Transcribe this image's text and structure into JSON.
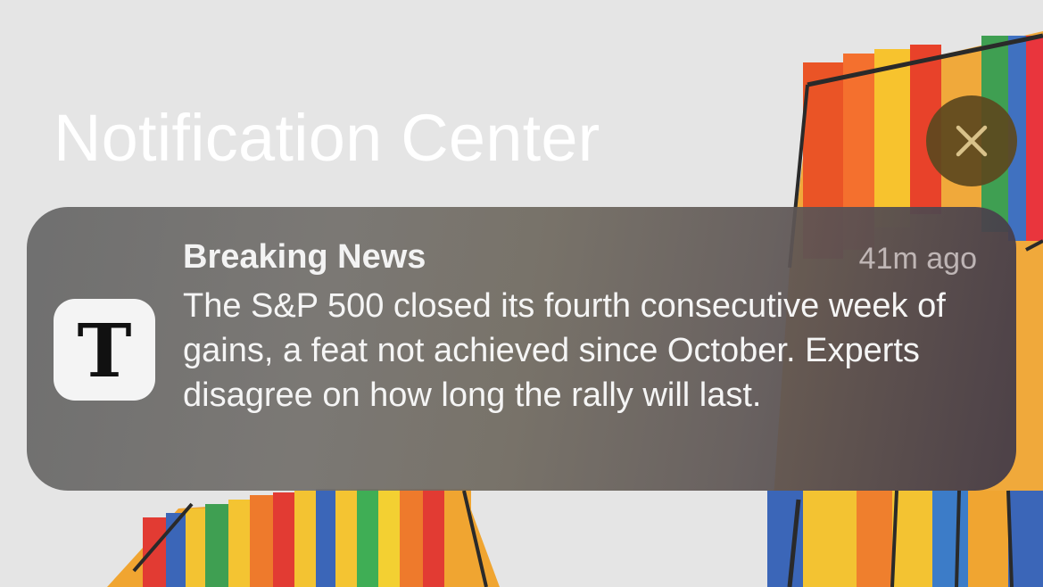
{
  "header": {
    "title": "Notification Center",
    "close_icon": "close-icon"
  },
  "notification": {
    "app_icon": "nyt-logo-icon",
    "app_icon_glyph": "T",
    "title": "Breaking News",
    "time": "41m ago",
    "body": "The S&P 500 closed its fourth consecutive week of gains, a feat not achieved since October. Experts disagree on how long the rally will last."
  },
  "colors": {
    "close_button_bg": "#5c481e",
    "close_button_glyph": "#d9c28a",
    "card_bg": "#6a6a6a",
    "title_text": "#ffffff"
  }
}
